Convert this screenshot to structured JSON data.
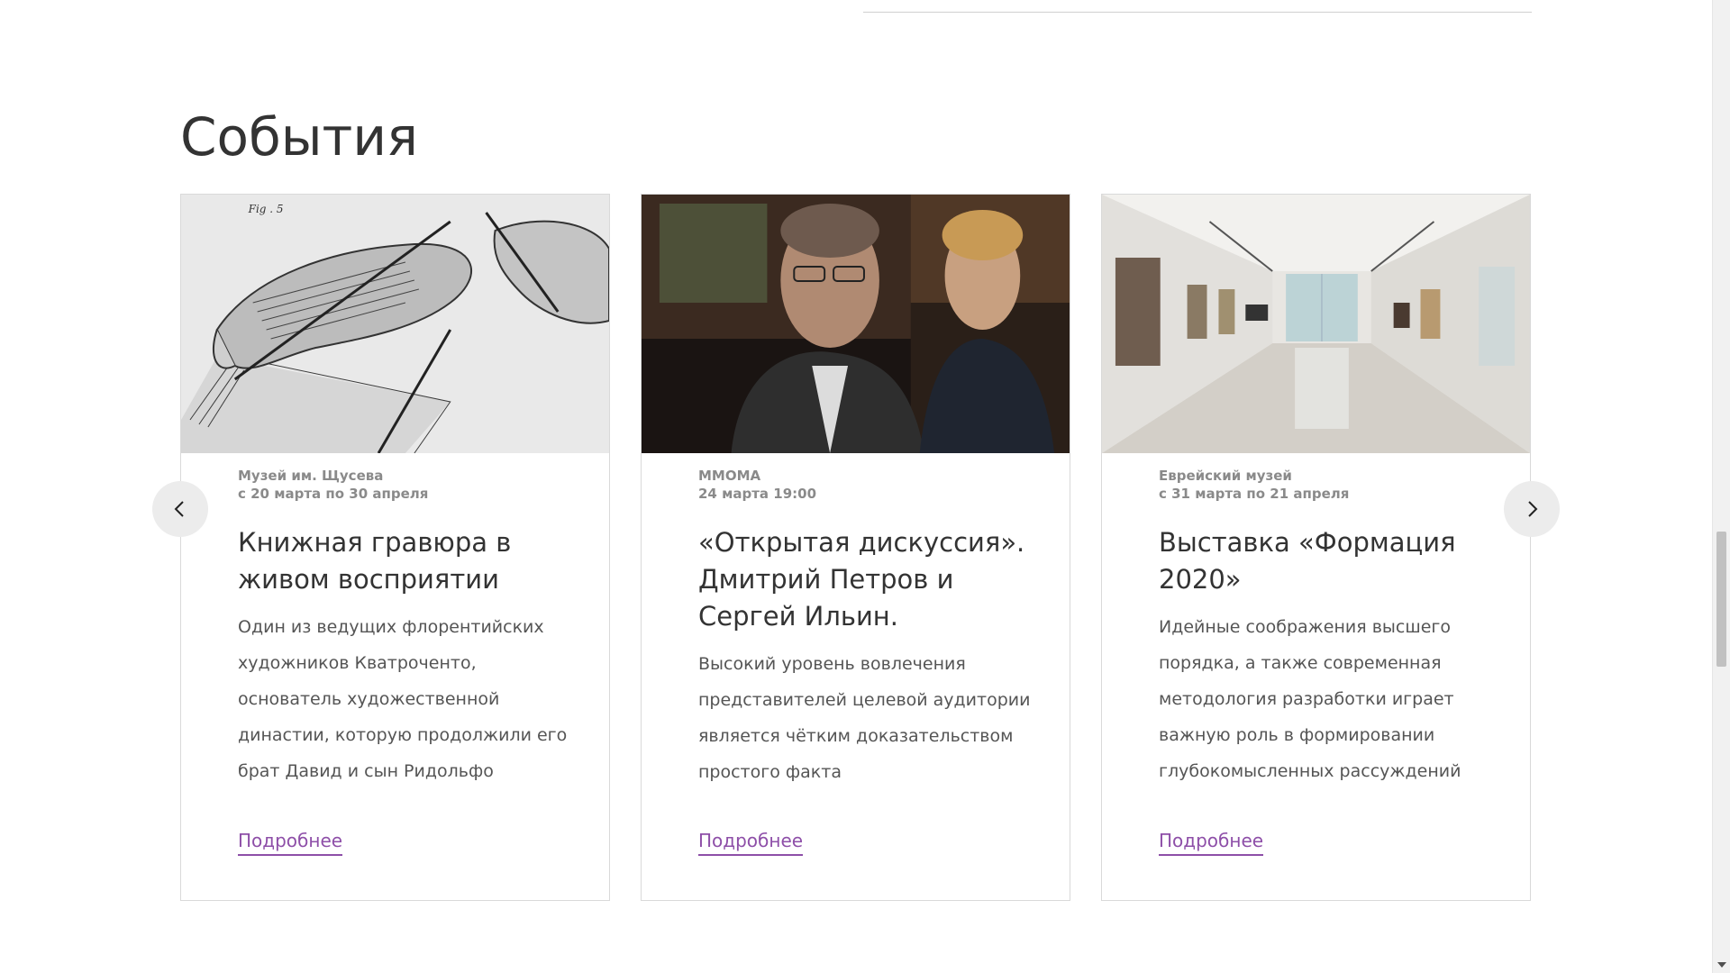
{
  "section": {
    "title": "События"
  },
  "events": [
    {
      "venue": "Музей им. Щусева",
      "date": "с 20 марта по 30 апреля",
      "title": "Книжная гравюра в живом восприятии",
      "description": "Один из ведущих флорентийских художников Кватроченто, основатель художественной династии, которую продолжили его брат Давид и сын Ридольфо",
      "link": "Подробнее"
    },
    {
      "venue": "ММОМА",
      "date": "24 марта 19:00",
      "title": "«Открытая дискуссия». Дмитрий Петров и Сергей Ильин.",
      "description": "Высокий уровень вовлечения представителей целевой аудитории является чётким доказательством простого факта",
      "link": "Подробнее"
    },
    {
      "venue": "Еврейский музей",
      "date": "с 31 марта по 21 апреля",
      "title": "Выставка «Формация 2020»",
      "description": "Идейные соображения высшего порядка, а также современная методология разработки играет важную роль в формировании глубокомысленных рассуждений",
      "link": "Подробнее"
    }
  ],
  "images": {
    "card1": "engraving-hands-illustration",
    "card2": "two-men-discussion-photo",
    "card3": "gallery-hall-photo"
  },
  "nav": {
    "prev_icon": "chevron-left-icon",
    "next_icon": "chevron-right-icon"
  },
  "colors": {
    "accent": "#8e4fa8",
    "text": "#333333",
    "meta": "#8a8a8a",
    "border": "#d9d9d9"
  }
}
